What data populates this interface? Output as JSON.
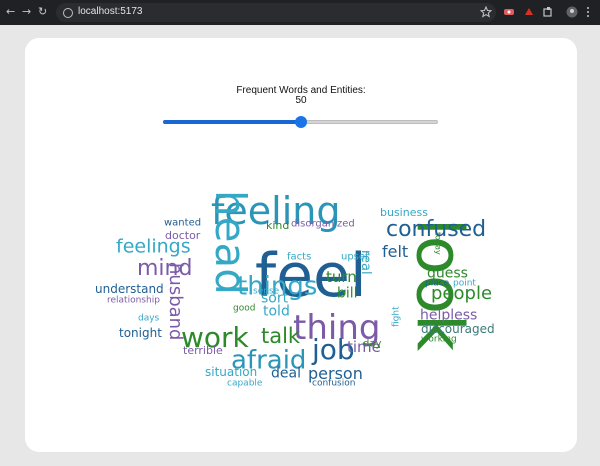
{
  "browser": {
    "url": "localhost:5173"
  },
  "controls": {
    "label": "Frequent Words and Entities:",
    "value": "50",
    "slider_fraction": 0.5
  },
  "colors": {
    "slider": "#1a73e8",
    "palette": [
      "#1f5f93",
      "#2b95b8",
      "#35a8c6",
      "#7b5ba8",
      "#2d8a2a",
      "#3a7a7a"
    ]
  },
  "cloud": {
    "words": [
      {
        "text": "feel",
        "color": "#1f5f93"
      },
      {
        "text": "look",
        "color": "#2d8a2a"
      },
      {
        "text": "feeling",
        "color": "#2b95b8"
      },
      {
        "text": "head",
        "color": "#35a8c6"
      },
      {
        "text": "thing",
        "color": "#7b5ba8"
      },
      {
        "text": "work",
        "color": "#2d8a2a"
      },
      {
        "text": "things",
        "color": "#35a8c6"
      },
      {
        "text": "afraid",
        "color": "#2b95b8"
      },
      {
        "text": "job",
        "color": "#1f5f93"
      },
      {
        "text": "confused",
        "color": "#1f5f93"
      },
      {
        "text": "mind",
        "color": "#7b5ba8"
      },
      {
        "text": "talk",
        "color": "#2d8a2a"
      },
      {
        "text": "feelings",
        "color": "#35a8c6"
      },
      {
        "text": "husband",
        "color": "#7b5ba8"
      },
      {
        "text": "people",
        "color": "#2d8a2a"
      },
      {
        "text": "person",
        "color": "#1f5f93"
      },
      {
        "text": "time",
        "color": "#7b5ba8"
      },
      {
        "text": "felt",
        "color": "#1f5f93"
      },
      {
        "text": "turn",
        "color": "#2d8a2a"
      },
      {
        "text": "told",
        "color": "#35a8c6"
      },
      {
        "text": "guess",
        "color": "#2d8a2a"
      },
      {
        "text": "helpless",
        "color": "#7b5ba8"
      },
      {
        "text": "deal",
        "color": "#1f5f93"
      },
      {
        "text": "sort",
        "color": "#35a8c6"
      },
      {
        "text": "bill",
        "color": "#2d8a2a"
      },
      {
        "text": "real",
        "color": "#35a8c6"
      },
      {
        "text": "discouraged",
        "color": "#3a7a7a"
      },
      {
        "text": "situation",
        "color": "#35a8c6"
      },
      {
        "text": "understand",
        "color": "#1f5f93"
      },
      {
        "text": "terrible",
        "color": "#7b5ba8"
      },
      {
        "text": "tonight",
        "color": "#1f5f93"
      },
      {
        "text": "doctor",
        "color": "#7b5ba8"
      },
      {
        "text": "business",
        "color": "#35a8c6"
      },
      {
        "text": "kind",
        "color": "#2d8a2a"
      },
      {
        "text": "wanted",
        "color": "#1f5f93"
      },
      {
        "text": "disorganized",
        "color": "#7b5ba8"
      },
      {
        "text": "facts",
        "color": "#35a8c6"
      },
      {
        "text": "upset",
        "color": "#35a8c6"
      },
      {
        "text": "place",
        "color": "#1f5f93"
      },
      {
        "text": "point",
        "color": "#35a8c6"
      },
      {
        "text": "working",
        "color": "#2d8a2a"
      },
      {
        "text": "relationship",
        "color": "#7b5ba8"
      },
      {
        "text": "days",
        "color": "#35a8c6"
      },
      {
        "text": "good",
        "color": "#2d8a2a"
      },
      {
        "text": "sense",
        "color": "#35a8c6"
      },
      {
        "text": "capable",
        "color": "#35a8c6"
      },
      {
        "text": "confusion",
        "color": "#1f5f93"
      },
      {
        "text": "day",
        "color": "#2d8a2a"
      },
      {
        "text": "fight",
        "color": "#35a8c6"
      },
      {
        "text": "today",
        "color": "#2d8a2a"
      }
    ]
  }
}
